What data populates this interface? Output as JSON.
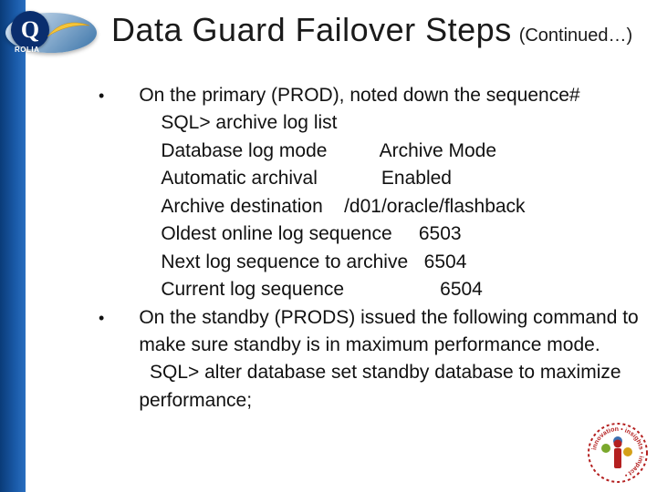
{
  "logo": {
    "brand": "ROLIA",
    "letter": "Q"
  },
  "title": {
    "main": "Data Guard Failover Steps",
    "continued": "(Continued…)"
  },
  "bullets": [
    {
      "text": "On the primary (PROD), noted down the sequence#",
      "sub_command": "SQL> archive log list",
      "kv": [
        {
          "label": "Database log mode",
          "value": "Archive Mode",
          "gap": "          "
        },
        {
          "label": "Automatic archival",
          "value": "Enabled",
          "gap": "            "
        },
        {
          "label": "Archive destination",
          "value": "/d01/oracle/flashback",
          "gap": "    "
        },
        {
          "label": "Oldest online log sequence",
          "value": "6503",
          "gap": "     "
        },
        {
          "label": "Next log sequence to archive",
          "value": "6504",
          "gap": "   "
        },
        {
          "label": "Current log sequence",
          "value": "6504",
          "gap": "                  "
        }
      ]
    },
    {
      "text": "On the standby (PRODS) issued the following command to make sure standby is in maximum performance mode.",
      "sub_command": "  SQL> alter database set standby database to maximize performance;"
    }
  ]
}
